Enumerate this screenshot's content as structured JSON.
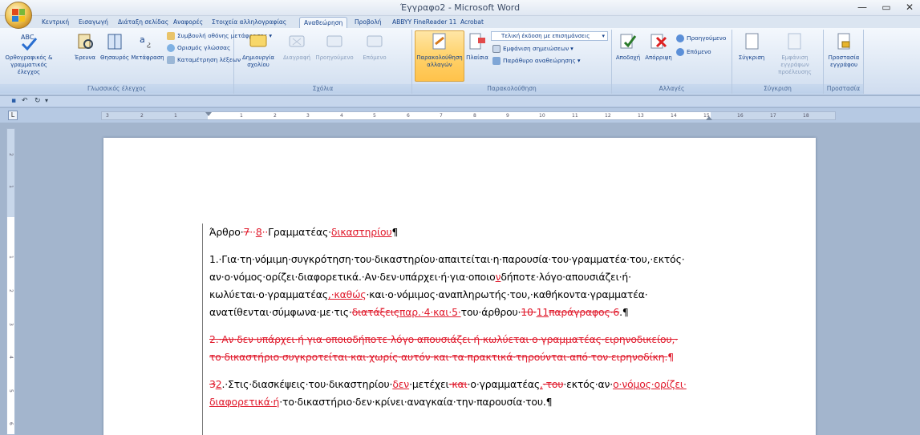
{
  "window": {
    "title": "Έγγραφο2 - Microsoft Word",
    "controls": {
      "minimize": "—",
      "restore": "▭",
      "close": "✕"
    }
  },
  "tabs": [
    {
      "label": "Κεντρική",
      "active": false
    },
    {
      "label": "Εισαγωγή",
      "active": false
    },
    {
      "label": "Διάταξη σελίδας",
      "active": false
    },
    {
      "label": "Αναφορές",
      "active": false
    },
    {
      "label": "Στοιχεία αλληλογραφίας",
      "active": false
    },
    {
      "label": "Αναθεώρηση",
      "active": true
    },
    {
      "label": "Προβολή",
      "active": false
    },
    {
      "label": "ABBYY FineReader 11",
      "active": false
    },
    {
      "label": "Acrobat",
      "active": false
    }
  ],
  "ribbon": {
    "proofing": {
      "title": "Γλωσσικός έλεγχος",
      "spelling_line1": "Ορθογραφικός &",
      "spelling_line2": "γραμματικός έλεγχος",
      "research": "Έρευνα",
      "thesaurus": "Θησαυρός",
      "translate": "Μετάφραση",
      "tooltip_translate": "Συμβουλή οθόνης μετάφρασης",
      "set_language": "Ορισμός γλώσσας",
      "word_count": "Καταμέτρηση λέξεων"
    },
    "comments": {
      "title": "Σχόλια",
      "new_line1": "Δημιουργία",
      "new_line2": "σχολίου",
      "delete": "Διαγραφή",
      "previous": "Προηγούμενο",
      "next": "Επόμενο"
    },
    "tracking": {
      "title": "Παρακολούθηση",
      "track_line1": "Παρακολούθηση",
      "track_line2": "αλλαγών",
      "balloons": "Πλαίσια",
      "display_for_review": "Τελική έκδοση με επισημάνσεις",
      "show_markup": "Εμφάνιση σημειώσεων",
      "reviewing_pane": "Παράθυρο αναθεώρησης"
    },
    "changes": {
      "title": "Αλλαγές",
      "accept": "Αποδοχή",
      "reject": "Απόρριψη",
      "previous": "Προηγούμενο",
      "next": "Επόμενο"
    },
    "compare": {
      "title": "Σύγκριση",
      "compare": "Σύγκριση",
      "show_source_line1": "Εμφάνιση εγγράφων",
      "show_source_line2": "προέλευσης"
    },
    "protect": {
      "title": "Προστασία",
      "protect_line1": "Προστασία",
      "protect_line2": "εγγράφου"
    }
  },
  "ruler": {
    "ticks": [
      "3",
      "2",
      "1",
      "1",
      "2",
      "3",
      "4",
      "5",
      "6",
      "7",
      "8",
      "9",
      "10",
      "11",
      "12",
      "13",
      "14",
      "15",
      "16",
      "17",
      "18"
    ],
    "vticks": [
      "2",
      "1",
      "1",
      "2",
      "3",
      "4",
      "5",
      "6"
    ],
    "tab_selector": "L"
  },
  "document": {
    "title": {
      "prefix": "Άρθρο·",
      "del_num": "7",
      "sep": "··",
      "ins_num": "8",
      "sep2": "··",
      "word": "Γραμματέας·",
      "ins_word": "δικαστηρίου",
      "pilcrow": "¶"
    },
    "p1": {
      "l1": "1.·Για·τη·νόμιμη·συγκρότηση·του·δικαστηρίου·απαιτείται·η·παρουσία·του·γραμματέα·του,·εκτός·",
      "l2a": "αν·ο·νόμος·ορίζει·διαφορετικά.·Αν·δεν·υπάρχει·ή·για·οποιο",
      "l2ins": "ν",
      "l2b": "δήποτε·λόγο·απουσιάζει·ή·",
      "l3a": "κωλύεται·ο·γραμματέας",
      "l3ins": ",·καθώς",
      "l3b": "·και·ο·νόμιμος·αναπληρωτής·του,·καθήκοντα·γραμματέα·",
      "l4a": "ανατίθενται·σύμφωνα·με·τις·",
      "l4del": "διατάξεις",
      "l4ins": "παρ.·4·και·5·",
      "l4b": "του·άρθρου·",
      "l4del2": "10·",
      "l4ins2": "11",
      "l4del3": "παράγραφος·6",
      "l4end": ".¶"
    },
    "p2": {
      "l1": "2.·Αν·δεν·υπάρχει·ή·για·οποιοδήποτε·λόγο·απουσιάζει·ή·κωλύεται·ο·γραμματέας·ειρηνοδικείου,·",
      "l2": "το·δικαστήριο·συγκροτείται·και·χωρίς·αυτόν·και·τα·πρακτικά·τηρούνται·από·τον·ειρηνοδίκη.",
      "pilcrow": "¶"
    },
    "p3": {
      "del_num": "3",
      "ins_num": "2",
      "l1a": ".·Στις·διασκέψεις·του·δικαστηρίου·",
      "l1ins": "δεν",
      "l1b": "·μετέχει",
      "l1del": "·και",
      "l1c": "·ο·γραμματέας",
      "l1ins2": ",",
      "l1del2": "·του",
      "l1d": "·εκτός·αν·",
      "l1ins3": "ο·νόμος·ορίζει·",
      "l2ins": "διαφορετικά·ή",
      "l2b": "·το·δικαστήριο·δεν·κρίνει·αναγκαία·την·παρουσία·του.¶"
    }
  },
  "colors": {
    "revision": "#e0192b",
    "ribbon_text": "#15428b",
    "frame": "#a3b5cd"
  }
}
